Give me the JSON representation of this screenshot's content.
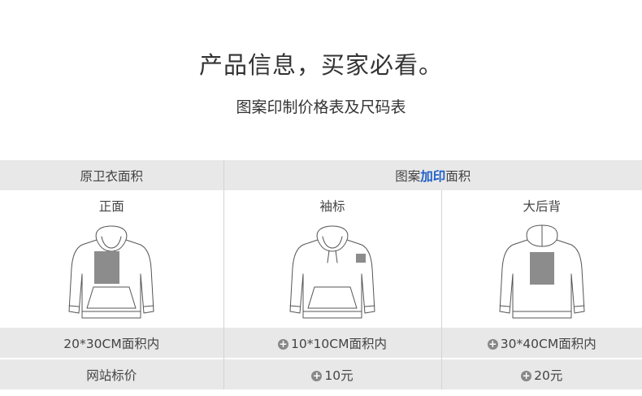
{
  "header": {
    "title": "产品信息，买家必看。",
    "subtitle": "图案印制价格表及尺码表"
  },
  "table": {
    "row1": {
      "left": "原卫衣面积",
      "right_prefix": "图案",
      "right_accent": "加印",
      "right_suffix": "面积"
    },
    "row2": [
      "正面",
      "袖标",
      "大后背"
    ],
    "areas": [
      "20*30CM面积内",
      "10*10CM面积内",
      "30*40CM面积内"
    ],
    "price_label": "网站标价",
    "prices": [
      "10元",
      "20元"
    ]
  },
  "colors": {
    "band": "#e8e8e8",
    "accent": "#1f5fc9",
    "print_area": "#8c8c8c"
  },
  "icons": [
    "plus-circle-icon"
  ]
}
